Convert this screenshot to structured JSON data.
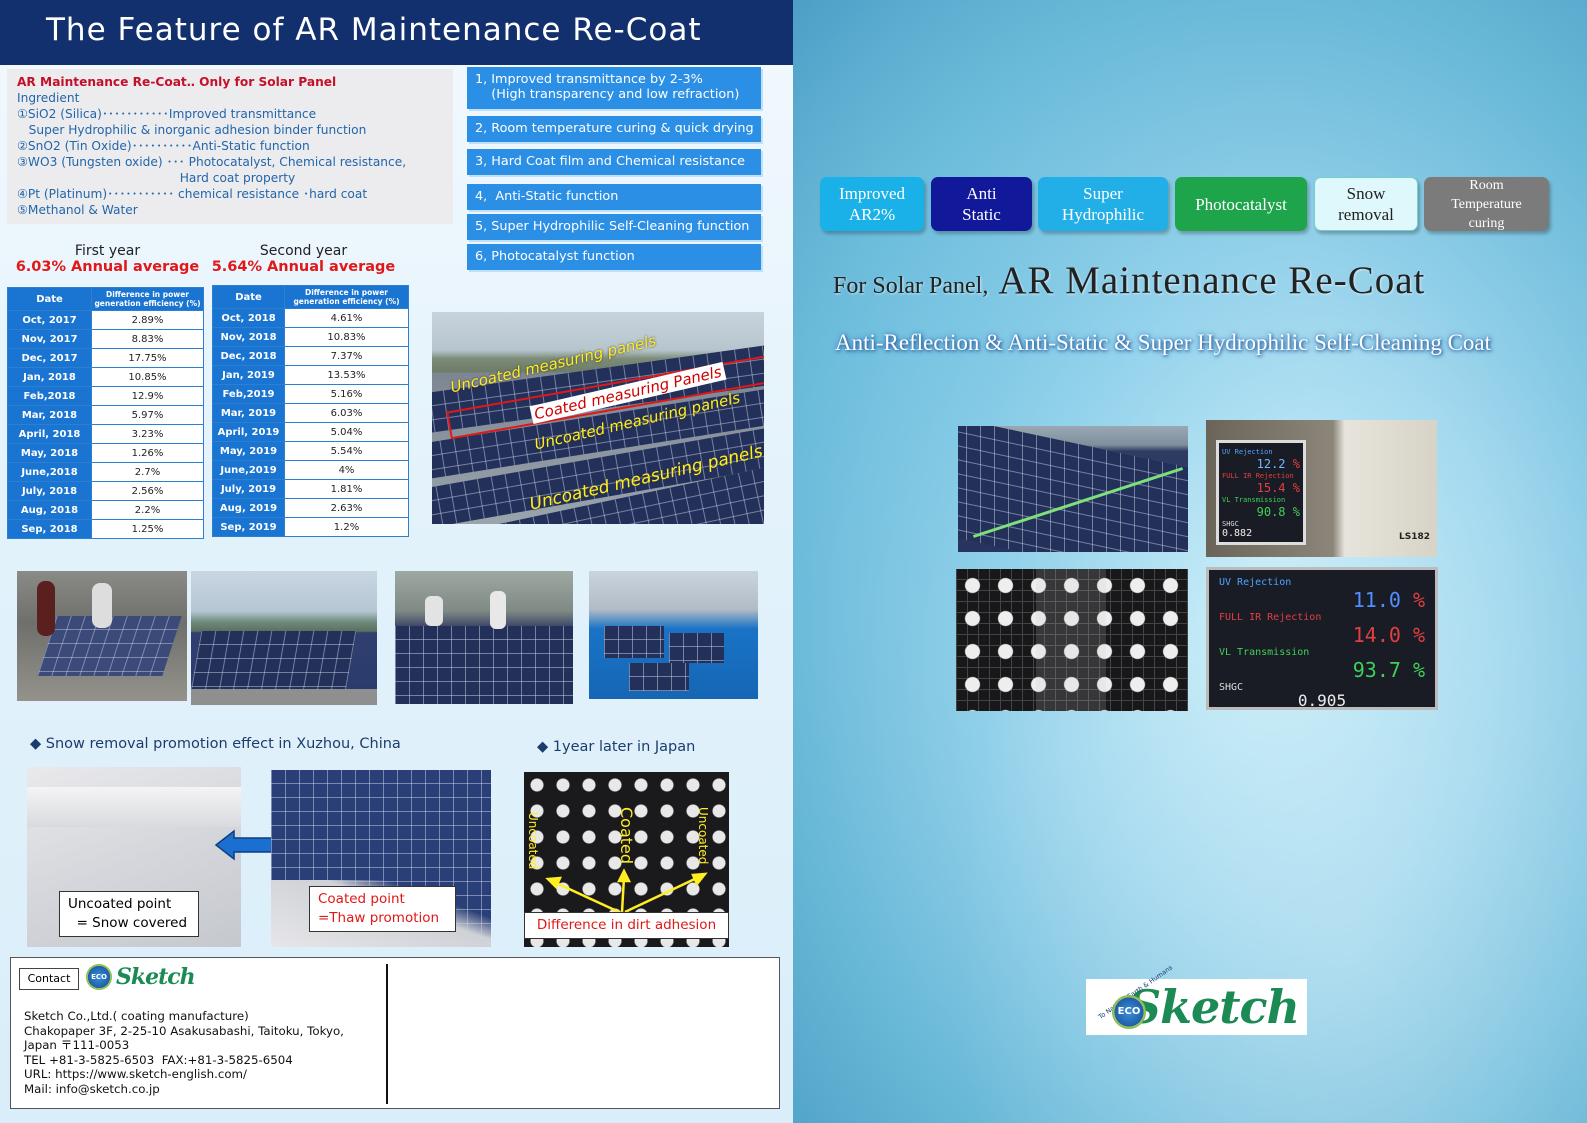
{
  "header": {
    "title": "The Feature of AR Maintenance Re-Coat"
  },
  "ingredients": {
    "title": "AR Maintenance Re-Coat‥ Only for Solar Panel",
    "lines": [
      "Ingredient",
      "①SiO2 (Silica)･･･････････Improved transmittance",
      "   Super Hydrophilic & inorganic adhesion binder function",
      "②SnO2 (Tin Oxide)･･････････Anti-Static function",
      "③WO3 (Tungsten oxide) ･･･ Photocatalyst, Chemical resistance,",
      "                                          Hard coat property",
      "④Pt (Platinum)･･･････････ chemical resistance ･hard coat",
      "⑤Methanol & Water"
    ]
  },
  "features": [
    "1, Improved transmittance by 2-3%\n    (High transparency and low refraction)",
    "2, Room temperature curing & quick drying",
    "3, Hard Coat film and Chemical resistance",
    "4,  Anti-Static function",
    "5, Super Hydrophilic Self-Cleaning function",
    "6, Photocatalyst function"
  ],
  "year1": {
    "label": "First year",
    "avg": "6.03% Annual average"
  },
  "year2": {
    "label": "Second year",
    "avg": "5.64% Annual average"
  },
  "table_headers": {
    "date": "Date",
    "diff": "Difference in power generation efficiency (%)"
  },
  "table1": [
    [
      "Oct, 2017",
      "2.89%"
    ],
    [
      "Nov, 2017",
      "8.83%"
    ],
    [
      "Dec, 2017",
      "17.75%"
    ],
    [
      "Jan, 2018",
      "10.85%"
    ],
    [
      "Feb,2018",
      "12.9%"
    ],
    [
      "Mar, 2018",
      "5.97%"
    ],
    [
      "April, 2018",
      "3.23%"
    ],
    [
      "May, 2018",
      "1.26%"
    ],
    [
      "June,2018",
      "2.7%"
    ],
    [
      "July, 2018",
      "2.56%"
    ],
    [
      "Aug, 2018",
      "2.2%"
    ],
    [
      "Sep, 2018",
      "1.25%"
    ]
  ],
  "table2": [
    [
      "Oct, 2018",
      "4.61%"
    ],
    [
      "Nov, 2018",
      "10.83%"
    ],
    [
      "Dec, 2018",
      "7.37%"
    ],
    [
      "Jan, 2019",
      "13.53%"
    ],
    [
      "Feb,2019",
      "5.16%"
    ],
    [
      "Mar, 2019",
      "6.03%"
    ],
    [
      "April, 2019",
      "5.04%"
    ],
    [
      "May, 2019",
      "5.54%"
    ],
    [
      "June,2019",
      "4%"
    ],
    [
      "July, 2019",
      "1.81%"
    ],
    [
      "Aug, 2019",
      "2.63%"
    ],
    [
      "Sep, 2019",
      "1.2%"
    ]
  ],
  "field_photo": {
    "label1": "Uncoated measuring panels",
    "label2": "Coated measuring Panels",
    "label3": "Uncoated measuring panels",
    "label4": "Uncoated measuring panels"
  },
  "snow": {
    "heading": "Snow removal promotion effect in Xuzhou, China",
    "uncoated": "Uncoated point\n  = Snow covered",
    "coated": "Coated point\n=Thaw promotion"
  },
  "japan": {
    "heading": "1year later in Japan",
    "uncoated_left": "Uncoated",
    "coated": "Coated",
    "uncoated_right": "Uncoated",
    "caption": "Difference in dirt adhesion"
  },
  "contact": {
    "button": "Contact",
    "info": "Sketch Co.,Ltd.( coating manufacture)\nChakopaper 3F, 2-25-10 Asakusabashi, Taitoku, Tokyo,\nJapan 〒111-0053\nTEL +81-3-5825-6503  FAX:+81-3-5825-6504\nURL: https://www.sketch-english.com/\nMail: info@sketch.co.jp"
  },
  "logo": {
    "eco": "ECO",
    "brand": "Sketch",
    "arc": "To Nature, Earth & Humans"
  },
  "chips": [
    {
      "label": "Improved AR2%",
      "color": "#1ab1e8"
    },
    {
      "label": "Anti Static",
      "color": "#12189a"
    },
    {
      "label": "Super Hydrophilic",
      "color": "#22aee6"
    },
    {
      "label": "Photocatalyst",
      "color": "#1ea54b"
    },
    {
      "label": "Snow removal",
      "color": "#dff8fb"
    },
    {
      "label": "Room Temperature curing",
      "color": "#7b7b7b"
    }
  ],
  "right_title": {
    "small": "For Solar Panel,",
    "big": "AR  Maintenance Re-Coat"
  },
  "right_subtitle": "Anti-Reflection & Anti-Static & Super Hydrophilic Self-Cleaning Coat",
  "meter1": {
    "r1_label": "UV Rejection",
    "r1": "12.2",
    "r2_label": "FULL IR Rejection",
    "r2": "15.4",
    "r3_label": "VL Transmission",
    "r3": "90.8",
    "r4_label": "SHGC",
    "r4": "0.882",
    "unit": "%",
    "model": "LS182"
  },
  "meter2": {
    "r1_label": "UV Rejection",
    "r1": "11.0",
    "r2_label": "FULL IR Rejection",
    "r2": "14.0",
    "r3_label": "VL Transmission",
    "r3": "93.7",
    "r4_label": "SHGC",
    "r4": "0.905",
    "unit": "%"
  }
}
